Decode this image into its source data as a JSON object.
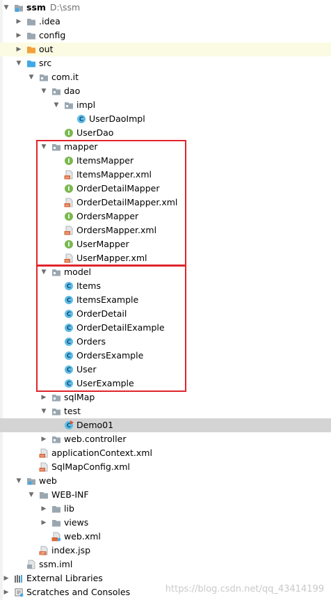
{
  "project": {
    "name": "ssm",
    "path": "D:\\ssm"
  },
  "items": [
    {
      "text": "ssm",
      "extra": "D:\\ssm",
      "level": 0,
      "arrow": "down",
      "icon": "project-folder-icon",
      "bold": true
    },
    {
      "text": ".idea",
      "level": 1,
      "arrow": "right",
      "icon": "folder-icon"
    },
    {
      "text": "config",
      "level": 1,
      "arrow": "right",
      "icon": "folder-icon"
    },
    {
      "text": "out",
      "level": 1,
      "arrow": "right",
      "icon": "excluded-folder-icon",
      "row_class": "out"
    },
    {
      "text": "src",
      "level": 1,
      "arrow": "down",
      "icon": "source-folder-icon"
    },
    {
      "text": "com.it",
      "level": 2,
      "arrow": "down",
      "icon": "package-icon"
    },
    {
      "text": "dao",
      "level": 3,
      "arrow": "down",
      "icon": "package-icon"
    },
    {
      "text": "impl",
      "level": 4,
      "arrow": "down",
      "icon": "package-icon"
    },
    {
      "text": "UserDaoImpl",
      "level": 5,
      "arrow": "",
      "icon": "class-icon"
    },
    {
      "text": "UserDao",
      "level": 4,
      "arrow": "",
      "icon": "interface-icon"
    },
    {
      "text": "mapper",
      "level": 3,
      "arrow": "down",
      "icon": "package-icon"
    },
    {
      "text": "ItemsMapper",
      "level": 4,
      "arrow": "",
      "icon": "interface-icon"
    },
    {
      "text": "ItemsMapper.xml",
      "level": 4,
      "arrow": "",
      "icon": "xml-file-icon"
    },
    {
      "text": "OrderDetailMapper",
      "level": 4,
      "arrow": "",
      "icon": "interface-icon"
    },
    {
      "text": "OrderDetailMapper.xml",
      "level": 4,
      "arrow": "",
      "icon": "xml-file-icon"
    },
    {
      "text": "OrdersMapper",
      "level": 4,
      "arrow": "",
      "icon": "interface-icon"
    },
    {
      "text": "OrdersMapper.xml",
      "level": 4,
      "arrow": "",
      "icon": "xml-file-icon"
    },
    {
      "text": "UserMapper",
      "level": 4,
      "arrow": "",
      "icon": "interface-icon"
    },
    {
      "text": "UserMapper.xml",
      "level": 4,
      "arrow": "",
      "icon": "xml-file-icon"
    },
    {
      "text": "model",
      "level": 3,
      "arrow": "down",
      "icon": "package-icon"
    },
    {
      "text": "Items",
      "level": 4,
      "arrow": "",
      "icon": "class-icon"
    },
    {
      "text": "ItemsExample",
      "level": 4,
      "arrow": "",
      "icon": "class-icon"
    },
    {
      "text": "OrderDetail",
      "level": 4,
      "arrow": "",
      "icon": "class-icon"
    },
    {
      "text": "OrderDetailExample",
      "level": 4,
      "arrow": "",
      "icon": "class-icon"
    },
    {
      "text": "Orders",
      "level": 4,
      "arrow": "",
      "icon": "class-icon"
    },
    {
      "text": "OrdersExample",
      "level": 4,
      "arrow": "",
      "icon": "class-icon"
    },
    {
      "text": "User",
      "level": 4,
      "arrow": "",
      "icon": "class-icon"
    },
    {
      "text": "UserExample",
      "level": 4,
      "arrow": "",
      "icon": "class-icon"
    },
    {
      "text": "sqlMap",
      "level": 3,
      "arrow": "right",
      "icon": "package-icon"
    },
    {
      "text": "test",
      "level": 3,
      "arrow": "down",
      "icon": "package-icon"
    },
    {
      "text": "Demo01",
      "level": 4,
      "arrow": "",
      "icon": "runnable-class-icon",
      "row_class": "sel"
    },
    {
      "text": "web.controller",
      "level": 3,
      "arrow": "right",
      "icon": "package-icon"
    },
    {
      "text": "applicationContext.xml",
      "level": 2,
      "arrow": "",
      "icon": "xml-file-icon"
    },
    {
      "text": "SqlMapConfig.xml",
      "level": 2,
      "arrow": "",
      "icon": "xml-file-icon"
    },
    {
      "text": "web",
      "level": 1,
      "arrow": "down",
      "icon": "web-folder-icon"
    },
    {
      "text": "WEB-INF",
      "level": 2,
      "arrow": "down",
      "icon": "folder-icon"
    },
    {
      "text": "lib",
      "level": 3,
      "arrow": "right",
      "icon": "folder-icon"
    },
    {
      "text": "views",
      "level": 3,
      "arrow": "right",
      "icon": "folder-icon"
    },
    {
      "text": "web.xml",
      "level": 3,
      "arrow": "",
      "icon": "web-xml-icon"
    },
    {
      "text": "index.jsp",
      "level": 2,
      "arrow": "",
      "icon": "jsp-file-icon"
    },
    {
      "text": "ssm.iml",
      "level": 1,
      "arrow": "",
      "icon": "iml-file-icon"
    },
    {
      "text": "External Libraries",
      "level": 0,
      "arrow": "right",
      "icon": "libraries-icon"
    },
    {
      "text": "Scratches and Consoles",
      "level": 0,
      "arrow": "right",
      "icon": "scratches-icon"
    }
  ],
  "watermark": "https://blog.csdn.net/qq_43414199",
  "colors": {
    "highlight_box": "#e0242b",
    "selected_row": "#d4d4d4",
    "excluded_row": "#fbfbe4"
  }
}
